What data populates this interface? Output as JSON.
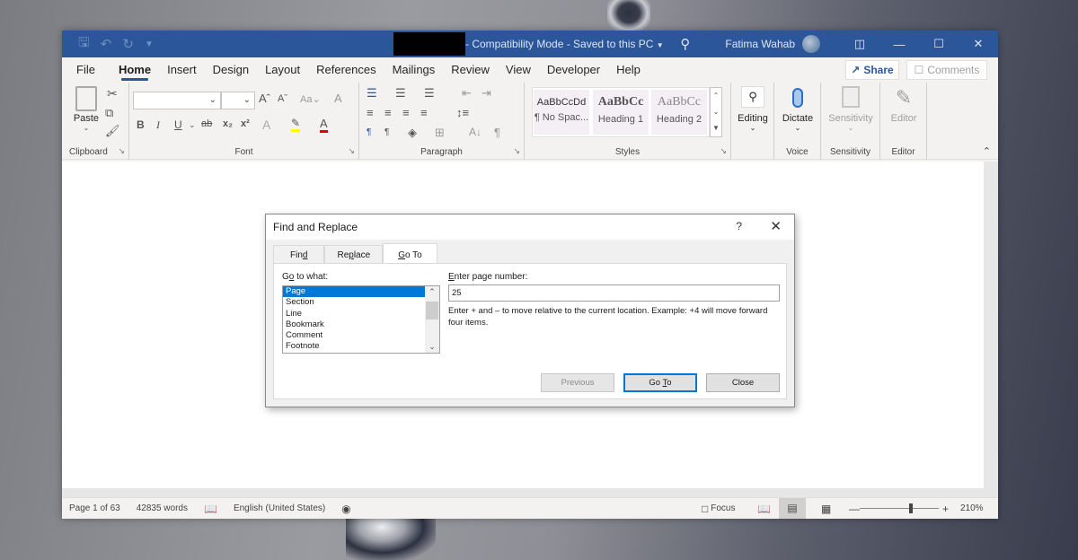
{
  "window": {
    "title": "- Compatibility Mode - Saved to this PC",
    "user_name": "Fatima Wahab",
    "title_dropdown_icon": "chevron-down-icon"
  },
  "menu": {
    "tabs": [
      "File",
      "Home",
      "Insert",
      "Design",
      "Layout",
      "References",
      "Mailings",
      "Review",
      "View",
      "Developer",
      "Help"
    ],
    "active_tab": "Home",
    "share_label": "Share",
    "comments_label": "Comments"
  },
  "ribbon": {
    "clipboard": {
      "paste_label": "Paste",
      "group_label": "Clipboard"
    },
    "font": {
      "font_name": "",
      "font_size": "",
      "group_label": "Font",
      "change_case_label": "Aa"
    },
    "paragraph": {
      "group_label": "Paragraph"
    },
    "styles": {
      "group_label": "Styles",
      "items": [
        {
          "sample": "AaBbCcDd",
          "name": "¶ No Spac..."
        },
        {
          "sample": "AaBbCc",
          "name": "Heading 1"
        },
        {
          "sample": "AaBbCc",
          "name": "Heading 2"
        }
      ]
    },
    "editing": {
      "label": "Editing"
    },
    "voice": {
      "label": "Dictate",
      "group_label": "Voice"
    },
    "sensitivity": {
      "label": "Sensitivity",
      "group_label": "Sensitivity"
    },
    "editor": {
      "label": "Editor",
      "group_label": "Editor"
    }
  },
  "dialog": {
    "title": "Find and Replace",
    "help": "?",
    "tabs": [
      {
        "label_pre": "Fin",
        "accel": "d",
        "label_post": ""
      },
      {
        "label_pre": "Re",
        "accel": "p",
        "label_post": "lace"
      },
      {
        "label_pre": "",
        "accel": "G",
        "label_post": "o To"
      }
    ],
    "active_tab": "Go To",
    "goto_what_label_pre": "G",
    "goto_what_accel": "o",
    "goto_what_label_post": " to what:",
    "goto_items": [
      "Page",
      "Section",
      "Line",
      "Bookmark",
      "Comment",
      "Footnote"
    ],
    "selected_item": "Page",
    "page_label_accel": "E",
    "page_label_post": "nter page number:",
    "page_value": "25",
    "hint": "Enter + and – to move relative to the current location. Example: +4 will move forward four items.",
    "buttons": {
      "previous": "Previous",
      "goto_pre": "Go ",
      "goto_accel": "T",
      "goto_post": "o",
      "close": "Close"
    }
  },
  "status": {
    "page": "Page 1 of 63",
    "words": "42835 words",
    "language": "English (United States)",
    "focus": "Focus",
    "zoom": "210%"
  }
}
